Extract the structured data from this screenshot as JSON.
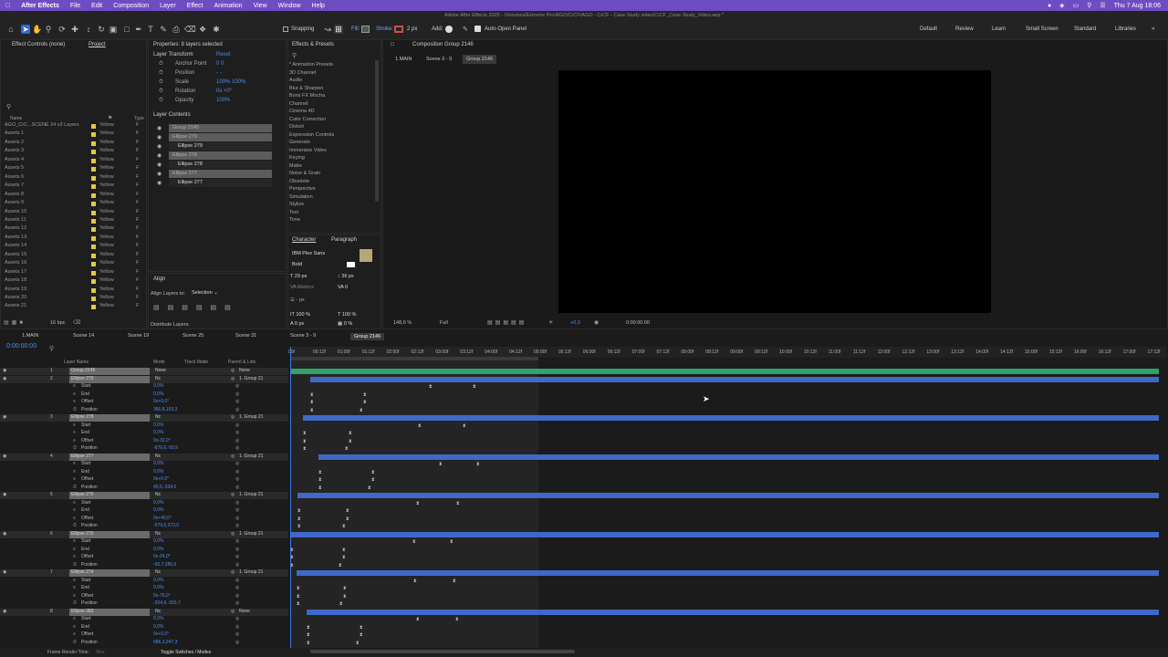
{
  "menubar": {
    "app_name": "After Effects",
    "items": [
      "File",
      "Edit",
      "Composition",
      "Layer",
      "Effect",
      "Animation",
      "View",
      "Window",
      "Help"
    ],
    "clock": "Thu 7 Aug  18:06"
  },
  "toolbar": {
    "title": "Adobe After Effects 2025 - /Volumes/Extreme Pro/AGO/CrCF/AGO - CrCF - Case Study video/CrCF_Case Study_Video.aep *",
    "snapping_label": "Snapping",
    "fill_label": "Fill:",
    "stroke_label": "Stroke:",
    "stroke_width": "2 px",
    "add_label": "Add:",
    "auto_open_label": "Auto-Open Panel",
    "workspaces": [
      "Default",
      "Review",
      "Learn",
      "Small Screen",
      "Standard",
      "Libraries"
    ]
  },
  "project": {
    "tab_effect_controls": "Effect Controls (none)",
    "tab_project": "Project",
    "col_name": "Name",
    "col_type": "Type",
    "rows": [
      {
        "name": "AGO_CrC...SCENE 24 v3 Layers",
        "label": "Yellow",
        "type": "F"
      },
      {
        "name": "Assets 1",
        "label": "Yellow",
        "type": "F"
      },
      {
        "name": "Assets 2",
        "label": "Yellow",
        "type": "F"
      },
      {
        "name": "Assets 3",
        "label": "Yellow",
        "type": "F"
      },
      {
        "name": "Assets 4",
        "label": "Yellow",
        "type": "F"
      },
      {
        "name": "Assets 5",
        "label": "Yellow",
        "type": "F"
      },
      {
        "name": "Assets 6",
        "label": "Yellow",
        "type": "F"
      },
      {
        "name": "Assets 7",
        "label": "Yellow",
        "type": "F"
      },
      {
        "name": "Assets 8",
        "label": "Yellow",
        "type": "F"
      },
      {
        "name": "Assets 9",
        "label": "Yellow",
        "type": "F"
      },
      {
        "name": "Assets 10",
        "label": "Yellow",
        "type": "F"
      },
      {
        "name": "Assets 11",
        "label": "Yellow",
        "type": "F"
      },
      {
        "name": "Assets 12",
        "label": "Yellow",
        "type": "F"
      },
      {
        "name": "Assets 13",
        "label": "Yellow",
        "type": "F"
      },
      {
        "name": "Assets 14",
        "label": "Yellow",
        "type": "F"
      },
      {
        "name": "Assets 15",
        "label": "Yellow",
        "type": "F"
      },
      {
        "name": "Assets 16",
        "label": "Yellow",
        "type": "F"
      },
      {
        "name": "Assets 17",
        "label": "Yellow",
        "type": "F"
      },
      {
        "name": "Assets 18",
        "label": "Yellow",
        "type": "F"
      },
      {
        "name": "Assets 19",
        "label": "Yellow",
        "type": "F"
      },
      {
        "name": "Assets 20",
        "label": "Yellow",
        "type": "F"
      },
      {
        "name": "Assets 21",
        "label": "Yellow",
        "type": "F"
      }
    ],
    "bpc": "16 bpc"
  },
  "properties": {
    "title": "Properties: 8 layers selected",
    "layer_transform": "Layer Transform",
    "reset": "Reset",
    "rows": [
      {
        "label": "Anchor Point",
        "value": "0         0"
      },
      {
        "label": "Position",
        "value": "-          -"
      },
      {
        "label": "Scale",
        "value": "100%     100%"
      },
      {
        "label": "Rotation",
        "value": "0x +0°"
      },
      {
        "label": "Opacity",
        "value": "100%"
      }
    ],
    "layer_contents": "Layer Contents",
    "contents": [
      {
        "name": "Group 2145",
        "kind": "hl"
      },
      {
        "name": "Ellipse 279",
        "kind": "hl"
      },
      {
        "name": "Ellipse 279",
        "kind": "dk"
      },
      {
        "name": "Ellipse 278",
        "kind": "hl"
      },
      {
        "name": "Ellipse 278",
        "kind": "dk"
      },
      {
        "name": "Ellipse 277",
        "kind": "hl"
      },
      {
        "name": "Ellipse 277",
        "kind": "dk"
      }
    ]
  },
  "align": {
    "title": "Align",
    "align_to_label": "Align Layers to:",
    "align_to_value": "Selection",
    "distribute": "Distribute Layers:"
  },
  "effects": {
    "title": "Effects & Presets",
    "items": [
      "* Animation Presets",
      "3D Channel",
      "Audio",
      "Blur & Sharpen",
      "Boris FX Mocha",
      "Channel",
      "Cinema 4D",
      "Color Correction",
      "Distort",
      "Expression Controls",
      "Generate",
      "Immersive Video",
      "Keying",
      "Matte",
      "Noise & Grain",
      "Obsolete",
      "Perspective",
      "Simulation",
      "Stylize",
      "Text",
      "Time"
    ]
  },
  "character": {
    "tab_character": "Character",
    "tab_paragraph": "Paragraph",
    "font": "IBM Plex Sans",
    "style": "Bold",
    "size": "29 px",
    "leading": "36 px",
    "kerning": "Metrics",
    "tracking": "0",
    "stroke": "- px",
    "vscale": "100 %",
    "hscale": "100 %",
    "baseline": "0 px",
    "tsume": "0 %"
  },
  "composition": {
    "title": "Composition Group 2146",
    "breadcrumbs": [
      "1.MAIN",
      "Scene 3 - 9",
      "Group 2146"
    ],
    "zoom": "148,6 %",
    "quality": "Full",
    "exposure": "+0,0",
    "timecode": "0:00:00:00"
  },
  "timeline": {
    "tabs": [
      "1.MAIN",
      "Scene 14",
      "Scene 19",
      "Scene 25",
      "Scene 31",
      "Scene 3 - 9",
      "Group 2146"
    ],
    "timecode": "0:00:00:00",
    "col_layer_name": "Layer Name",
    "col_mode": "Mode",
    "col_trkmat": "Track Matte",
    "col_parent": "Parent & Link",
    "ruler": [
      "00f",
      "00:12f",
      "01:00f",
      "01:12f",
      "02:00f",
      "02:12f",
      "03:00f",
      "03:12f",
      "04:00f",
      "04:12f",
      "05:00f",
      "05:12f",
      "06:00f",
      "06:12f",
      "07:00f",
      "07:12f",
      "08:00f",
      "08:12f",
      "09:00f",
      "09:12f",
      "10:00f",
      "10:12f",
      "11:00f",
      "11:12f",
      "12:00f",
      "12:12f",
      "13:00f",
      "13:12f",
      "14:00f",
      "14:12f",
      "15:00f",
      "15:12f",
      "16:00f",
      "16:12f",
      "17:00f",
      "17:12f"
    ],
    "layers": [
      {
        "num": "1",
        "name": "Group 2145",
        "mode": "None",
        "parent": "None",
        "sub": []
      },
      {
        "num": "2",
        "name": "Ellipse 279",
        "mode": "Nc",
        "parent": "1. Group 21",
        "sub": [
          {
            "l": "Start",
            "v": "0,0%"
          },
          {
            "l": "End",
            "v": "0,0%"
          },
          {
            "l": "Offset",
            "v": "0x+0,0°"
          },
          {
            "l": "Position",
            "v": "386,8,193,3"
          }
        ]
      },
      {
        "num": "3",
        "name": "Ellipse 278",
        "mode": "Nc",
        "parent": "1. Group 21",
        "sub": [
          {
            "l": "Start",
            "v": "0,0%"
          },
          {
            "l": "End",
            "v": "0,0%"
          },
          {
            "l": "Offset",
            "v": "0x-32,0°"
          },
          {
            "l": "Position",
            "v": "-876,6,-50,9"
          }
        ]
      },
      {
        "num": "4",
        "name": "Ellipse 277",
        "mode": "Nc",
        "parent": "1. Group 21",
        "sub": [
          {
            "l": "Start",
            "v": "0,0%"
          },
          {
            "l": "End",
            "v": "0,0%"
          },
          {
            "l": "Offset",
            "v": "0x+0,0°"
          },
          {
            "l": "Position",
            "v": "45,6,-334,5"
          }
        ]
      },
      {
        "num": "5",
        "name": "Ellipse 276",
        "mode": "Nc",
        "parent": "1. Group 21",
        "sub": [
          {
            "l": "Start",
            "v": "0,0%"
          },
          {
            "l": "End",
            "v": "0,0%"
          },
          {
            "l": "Offset",
            "v": "0x+40,0°"
          },
          {
            "l": "Position",
            "v": "-579,6,373,0"
          }
        ]
      },
      {
        "num": "6",
        "name": "Ellipse 275",
        "mode": "Nc",
        "parent": "1. Group 21",
        "sub": [
          {
            "l": "Start",
            "v": "0,0%"
          },
          {
            "l": "End",
            "v": "0,0%"
          },
          {
            "l": "Offset",
            "v": "0x-24,0°"
          },
          {
            "l": "Position",
            "v": "-65,7,386,6"
          }
        ]
      },
      {
        "num": "7",
        "name": "Ellipse 274",
        "mode": "Nc",
        "parent": "1. Group 21",
        "sub": [
          {
            "l": "Start",
            "v": "0,0%"
          },
          {
            "l": "End",
            "v": "0,0%"
          },
          {
            "l": "Offset",
            "v": "0x-76,0°"
          },
          {
            "l": "Position",
            "v": "-204,9,-355,7"
          }
        ]
      },
      {
        "num": "8",
        "name": "Ellipse 283",
        "mode": "Nc",
        "parent": "None",
        "sub": [
          {
            "l": "Start",
            "v": "0,0%"
          },
          {
            "l": "End",
            "v": "0,0%"
          },
          {
            "l": "Offset",
            "v": "0x+0,0°"
          },
          {
            "l": "Position",
            "v": "686,3,247,3"
          }
        ]
      }
    ],
    "footer_render": "Frame Render Time:",
    "footer_render_val": "0ms",
    "footer_toggle": "Toggle Switches / Modes"
  },
  "colors": {
    "accent": "#6f4cc2",
    "layer_bar": "#3e69c9",
    "group_bar": "#2fa36a",
    "label_yellow": "#e2c94a"
  }
}
